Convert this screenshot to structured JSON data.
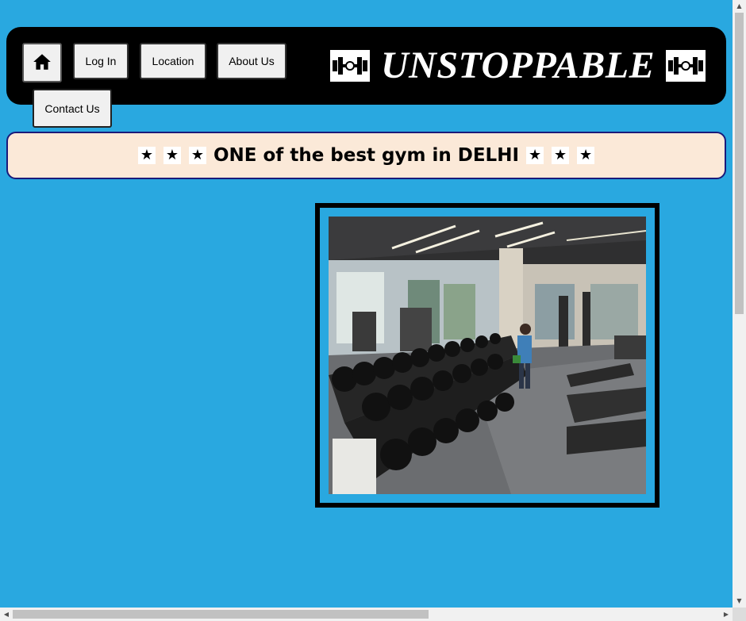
{
  "nav": {
    "home_icon": "home-icon",
    "login_label": "Log In",
    "location_label": "Location",
    "about_label": "About Us",
    "contact_label": "Contact Us"
  },
  "brand": {
    "title": "UNSTOPPABLE",
    "logo_icon": "dumbbell-icon"
  },
  "tagline": {
    "text": "ONE of the best gym in DELHI",
    "star_glyph": "★"
  },
  "hero": {
    "image_icon": "gym-interior-photo"
  },
  "colors": {
    "page_background": "#29a8e0",
    "navbar": "#000000",
    "tagline_background": "#fbe9d8",
    "tagline_border": "#1a1a7a"
  }
}
